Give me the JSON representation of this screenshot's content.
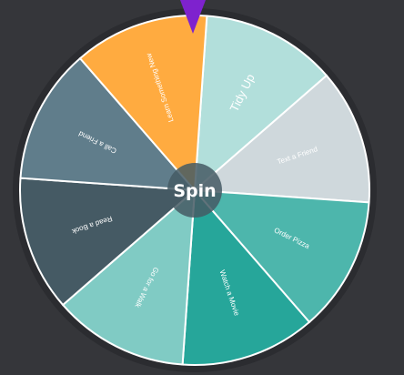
{
  "wheel": {
    "segments": [
      {
        "label": "Tidy Up",
        "color": "#b2dfdb",
        "text_color": "#ffffff"
      },
      {
        "label": "Text a Friend",
        "color": "#cfd8dc",
        "text_color": "#ffffff"
      },
      {
        "label": "Order Pizza",
        "color": "#4db6ac",
        "text_color": "#ffffff"
      },
      {
        "label": "Watch a Movie",
        "color": "#26a69a",
        "text_color": "#ffffff"
      },
      {
        "label": "Go for a Walk",
        "color": "#80cbc4",
        "text_color": "#ffffff"
      },
      {
        "label": "Read a Book",
        "color": "#455a64",
        "text_color": "#ffffff"
      },
      {
        "label": "Call a Friend",
        "color": "#607d8b",
        "text_color": "#ffffff"
      },
      {
        "label": "Learn Something New",
        "color": "#ffab40",
        "text_color": "#ffffff"
      }
    ],
    "spin_label": "Spin",
    "pointer_color": "#7e22ce",
    "hub_color": "#455a64",
    "rim_color": "#2b2c30"
  }
}
